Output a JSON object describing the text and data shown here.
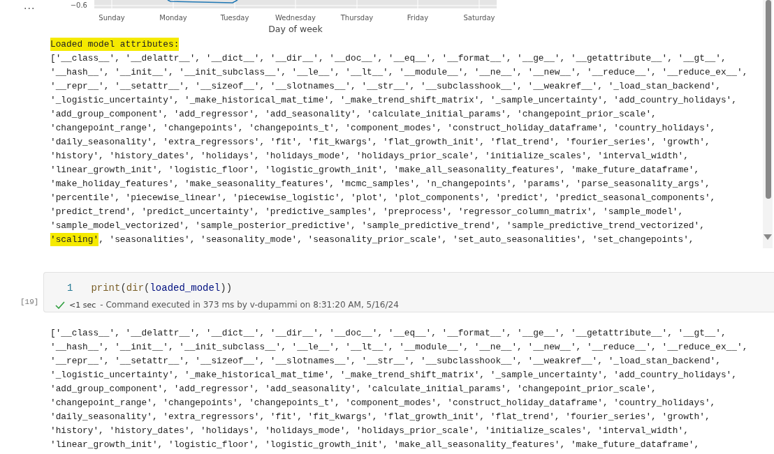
{
  "chart": {
    "ytick": "−0.6",
    "x_labels": [
      "Sunday",
      "Monday",
      "Tuesday",
      "Wednesday",
      "Thursday",
      "Friday",
      "Saturday"
    ],
    "xlabel": "Day of week"
  },
  "cell_menu": "...",
  "output_1": {
    "heading": {
      "text": "Loaded model attributes:",
      "highlighted": true
    },
    "lines": [
      "['__class__', '__delattr__', '__dict__', '__dir__', '__doc__', '__eq__', '__format__', '__ge__', '__getattribute__', '__gt__',",
      "'__hash__', '__init__', '__init_subclass__', '__le__', '__lt__', '__module__', '__ne__', '__new__', '__reduce__', '__reduce_ex__',",
      "'__repr__', '__setattr__', '__sizeof__', '__slotnames__', '__str__', '__subclasshook__', '__weakref__', '_load_stan_backend',",
      "'_logistic_uncertainty', '_make_historical_mat_time', '_make_trend_shift_matrix', '_sample_uncertainty', 'add_country_holidays',",
      "'add_group_component', 'add_regressor', 'add_seasonality', 'calculate_initial_params', 'changepoint_prior_scale',",
      "'changepoint_range', 'changepoints', 'changepoints_t', 'component_modes', 'construct_holiday_dataframe', 'country_holidays',",
      "'daily_seasonality', 'extra_regressors', 'fit', 'fit_kwargs', 'flat_growth_init', 'flat_trend', 'fourier_series', 'growth',",
      "'history', 'history_dates', 'holidays', 'holidays_mode', 'holidays_prior_scale', 'initialize_scales', 'interval_width',",
      "'linear_growth_init', 'logistic_floor', 'logistic_growth_init', 'make_all_seasonality_features', 'make_future_dataframe',",
      "'make_holiday_features', 'make_seasonality_features', 'mcmc_samples', 'n_changepoints', 'params', 'parse_seasonality_args',",
      "'percentile', 'piecewise_linear', 'piecewise_logistic', 'plot', 'plot_components', 'predict', 'predict_seasonal_components',",
      "'predict_trend', 'predict_uncertainty', 'predictive_samples', 'preprocess', 'regressor_column_matrix', 'sample_model',",
      "'sample_model_vectorized', 'sample_posterior_predictive', 'sample_predictive_trend', 'sample_predictive_trend_vectorized',",
      {
        "parts": [
          {
            "text": "'scaling'",
            "highlighted": true
          },
          {
            "text": ", 'seasonalities', 'seasonality_mode', 'seasonality_prior_scale', 'set_auto_seasonalities', 'set_changepoints',",
            "highlighted": false
          }
        ]
      }
    ]
  },
  "code_cell": {
    "line_number": "1",
    "tokens": [
      {
        "text": "print",
        "kind": "function"
      },
      {
        "text": "(",
        "kind": "punct"
      },
      {
        "text": "dir",
        "kind": "function"
      },
      {
        "text": "(",
        "kind": "punct"
      },
      {
        "text": "loaded_model",
        "kind": "variable"
      },
      {
        "text": "))",
        "kind": "punct"
      }
    ],
    "execution_count": "[19]",
    "succeeded": true,
    "duration": "<1 sec",
    "message": "- Command executed in 373 ms by v-dupammi on 8:31:20 AM, 5/16/24"
  },
  "output_2": {
    "lines": [
      "['__class__', '__delattr__', '__dict__', '__dir__', '__doc__', '__eq__', '__format__', '__ge__', '__getattribute__', '__gt__',",
      "'__hash__', '__init__', '__init_subclass__', '__le__', '__lt__', '__module__', '__ne__', '__new__', '__reduce__', '__reduce_ex__',",
      "'__repr__', '__setattr__', '__sizeof__', '__slotnames__', '__str__', '__subclasshook__', '__weakref__', '_load_stan_backend',",
      "'_logistic_uncertainty', '_make_historical_mat_time', '_make_trend_shift_matrix', '_sample_uncertainty', 'add_country_holidays',",
      "'add_group_component', 'add_regressor', 'add_seasonality', 'calculate_initial_params', 'changepoint_prior_scale',",
      "'changepoint_range', 'changepoints', 'changepoints_t', 'component_modes', 'construct_holiday_dataframe', 'country_holidays',",
      "'daily_seasonality', 'extra_regressors', 'fit', 'fit_kwargs', 'flat_growth_init', 'flat_trend', 'fourier_series', 'growth',",
      "'history', 'history_dates', 'holidays', 'holidays_mode', 'holidays_prior_scale', 'initialize_scales', 'interval_width',",
      "'linear_growth_init', 'logistic_floor', 'logistic_growth_init', 'make_all_seasonality_features', 'make_future_dataframe',"
    ]
  }
}
